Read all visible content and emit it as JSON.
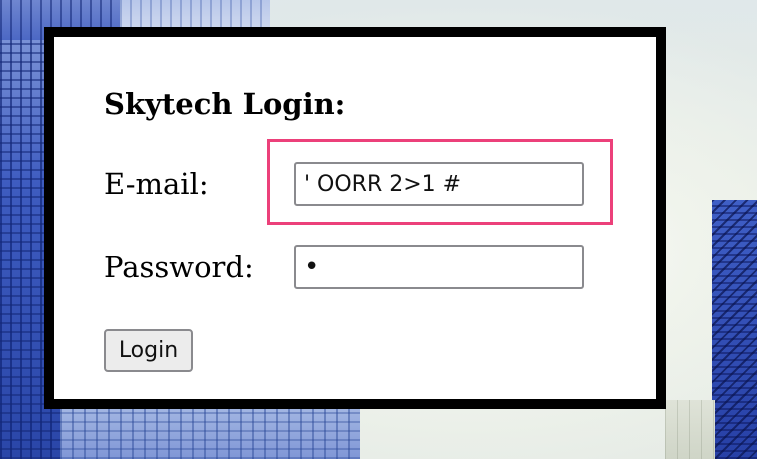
{
  "form": {
    "title": "Skytech Login:",
    "email_label": "E-mail:",
    "email_value": "' OORR 2>1 #",
    "password_label": "Password:",
    "password_value": "a",
    "login_button": "Login"
  },
  "colors": {
    "panel_border": "#000000",
    "highlight": "#ec407a"
  }
}
